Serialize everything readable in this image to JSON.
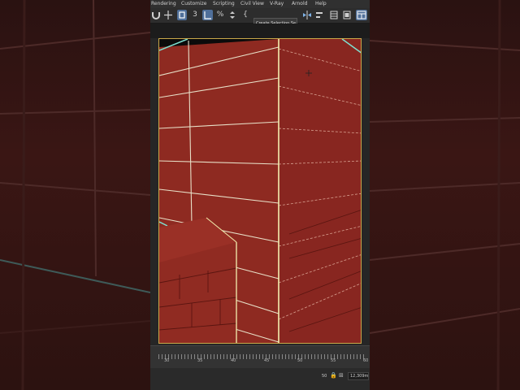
{
  "menu": {
    "items": [
      "Rendering",
      "Customize",
      "Scripting",
      "Civil View",
      "V-Ray",
      "Arnold",
      "Help"
    ]
  },
  "toolbar": {
    "icons": [
      "magnet-tool-icon",
      "move-icon",
      "select-icon",
      "snap-3d-icon",
      "angle-snap-icon",
      "percent-snap-icon",
      "spinner-snap-icon",
      "curly-brace-icon"
    ],
    "snap_3d_label": "3",
    "percent_label": "%",
    "selection_set_placeholder": "Create Selection Se"
  },
  "timeline": {
    "tick_labels": [
      "30",
      "35",
      "40",
      "45",
      "50",
      "55",
      "60"
    ]
  },
  "status": {
    "frame_value": "50",
    "field_value": "12,309m"
  },
  "colors": {
    "brick": "#8e2a21",
    "mortar_line": "#e8e0c8",
    "edge_highlight": "#f4f0b0",
    "selection_cyan": "#7fe0d0",
    "viewport_border": "#c9a84a"
  }
}
